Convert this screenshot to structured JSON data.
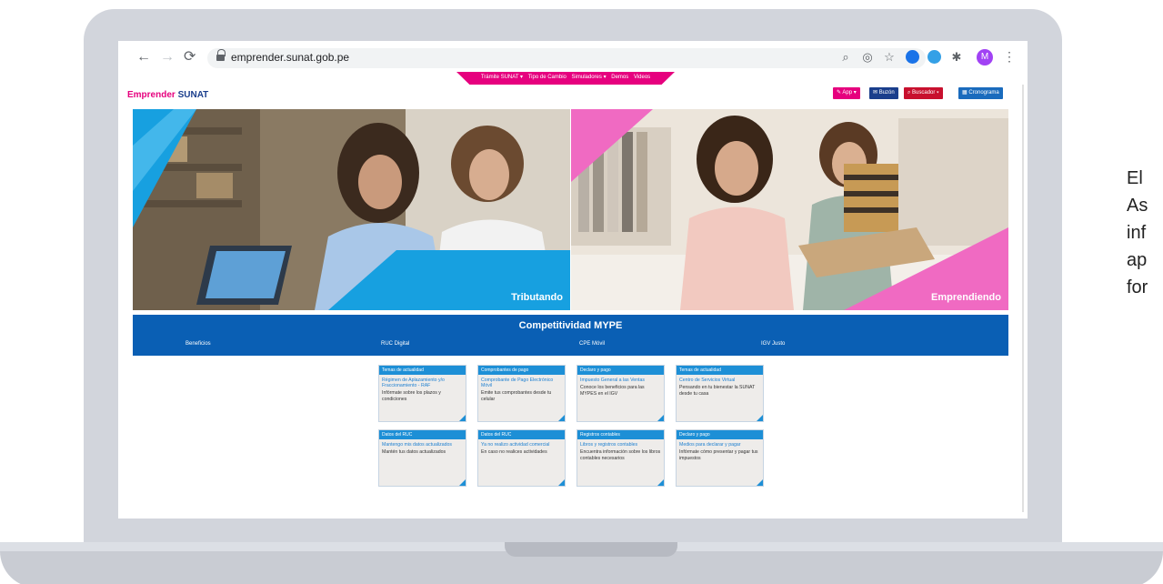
{
  "browser": {
    "url": "emprender.sunat.gob.pe",
    "avatar_letter": "M"
  },
  "site": {
    "logo_part1": "Emprender",
    "logo_part2": "SUNAT",
    "top_nav": [
      "Trámite SUNAT ▾",
      "Tipo de Cambio",
      "Simuladores ▾",
      "Demos",
      "Videos"
    ],
    "buttons": {
      "app": "App ▾",
      "buzon": "Buzón",
      "buscador": "Buscador ▾",
      "cronograma": "Cronograma"
    },
    "hero": {
      "left_caption": "Tributando",
      "right_caption": "Emprendiendo"
    },
    "band": {
      "title": "Competitividad MYPE",
      "links": [
        "Beneficios",
        "RUC Digital",
        "CPE Móvil",
        "IGV Justo"
      ]
    },
    "cards": [
      {
        "head": "Temas de actualidad",
        "title": "Régimen de Aplazamiento y/o Fraccionamiento - RAF",
        "text": "Infórmate sobre los plazos y condiciones"
      },
      {
        "head": "Comprobantes de pago",
        "title": "Comprobante de Pago Electrónico Móvil",
        "text": "Emite tus comprobantes desde tu celular"
      },
      {
        "head": "Declaro y pago",
        "title": "Impuesto General a las Ventas",
        "text": "Conoce los beneficios para las MYPES en el IGV"
      },
      {
        "head": "Temas de actualidad",
        "title": "Centro de Servicios Virtual",
        "text": "Pensando en tu bienestar la SUNAT desde tu casa"
      },
      {
        "head": "Datos del RUC",
        "title": "Mantengo mis datos actualizados",
        "text": "Mantén tus datos actualizados"
      },
      {
        "head": "Datos del RUC",
        "title": "Ya no realizo actividad comercial",
        "text": "En caso no realices actividades"
      },
      {
        "head": "Registros contables",
        "title": "Libros y registros contables",
        "text": "Encuentra información sobre los libros contables necesarios"
      },
      {
        "head": "Declaro y pago",
        "title": "Medios para declarar y pagar",
        "text": "Infórmate cómo presentar y pagar tus impuestos"
      }
    ]
  },
  "side_text": [
    "El",
    "As",
    "inf",
    "ap",
    "for"
  ],
  "colors": {
    "magenta": "#e6007e",
    "sky": "#1d8fd6",
    "navy": "#1a3e8c",
    "band_blue": "#0a5fb4",
    "pink": "#f06ac2",
    "red": "#c8102e"
  },
  "icons": [
    "back-arrow-icon",
    "forward-arrow-icon",
    "reload-icon",
    "lock-icon",
    "zoom-icon",
    "eye-off-icon",
    "star-icon",
    "puzzle-icon",
    "more-icon"
  ]
}
